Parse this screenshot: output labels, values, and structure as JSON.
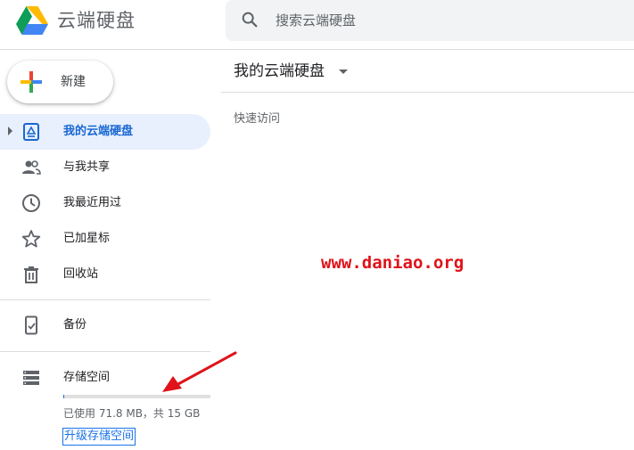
{
  "header": {
    "app_title": "云端硬盘",
    "search": {
      "placeholder": "搜索云端硬盘"
    }
  },
  "sidebar": {
    "new_button_label": "新建",
    "items": [
      {
        "label": "我的云端硬盘",
        "icon": "drive-icon",
        "active": true
      },
      {
        "label": "与我共享",
        "icon": "shared-people-icon",
        "active": false
      },
      {
        "label": "我最近用过",
        "icon": "clock-icon",
        "active": false
      },
      {
        "label": "已加星标",
        "icon": "star-icon",
        "active": false
      },
      {
        "label": "回收站",
        "icon": "trash-icon",
        "active": false
      }
    ],
    "backup": {
      "label": "备份",
      "icon": "backup-device-icon"
    },
    "storage": {
      "label": "存储空间",
      "icon": "storage-icon",
      "used_fraction": 0.005,
      "usage_text": "已使用 71.8 MB，共 15 GB",
      "upgrade_label": "升级存储空间"
    }
  },
  "main": {
    "title": "我的云端硬盘",
    "quick_access_label": "快速访问"
  },
  "watermark": {
    "text": "www.daniao.org",
    "color": "#e0121a"
  },
  "colors": {
    "accent": "#1a73e8",
    "active_bg": "#e8f0fe",
    "active_text": "#1967d2",
    "annotation_arrow": "#e0121a"
  }
}
